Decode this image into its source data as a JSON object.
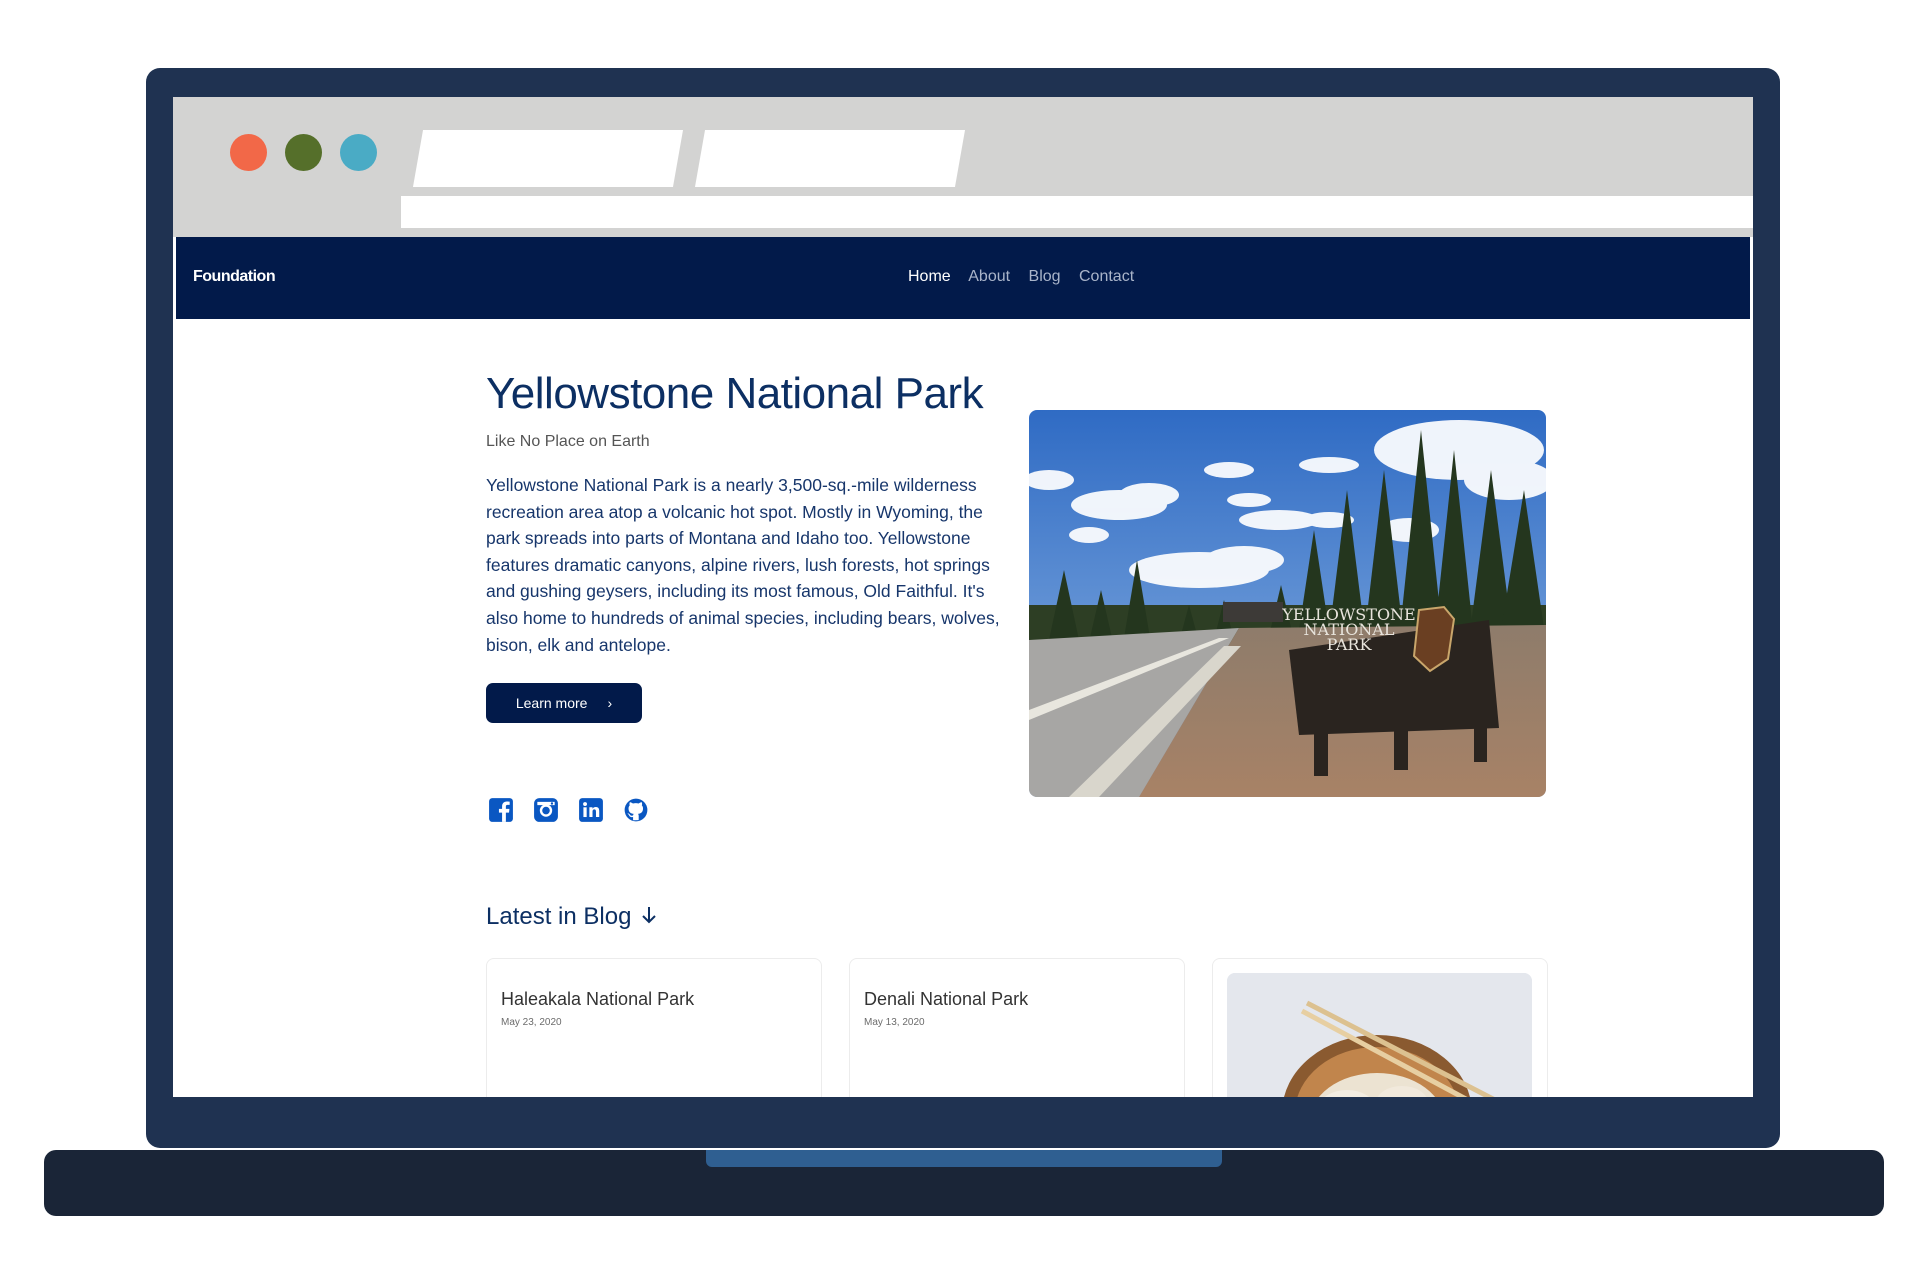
{
  "site": {
    "brand": "Foundation",
    "nav": [
      "Home",
      "About",
      "Blog",
      "Contact"
    ],
    "active_nav": "Home"
  },
  "hero": {
    "title": "Yellowstone National Park",
    "subtitle": "Like No Place on Earth",
    "body": "Yellowstone National Park is a nearly 3,500-sq.-mile wilderness recreation area atop a volcanic hot spot. Mostly in Wyoming, the park spreads into parts of Montana and Idaho too. Yellowstone features dramatic canyons, alpine rivers, lush forests, hot springs and gushing geysers, including its most famous, Old Faithful. It's also home to hundreds of animal species, including bears, wolves, bison, elk and antelope.",
    "button": "Learn more",
    "photo_sign_text": [
      "YELLOWSTONE",
      "NATIONAL",
      "PARK"
    ],
    "social_icons": [
      "facebook-icon",
      "instagram-icon",
      "linkedin-icon",
      "github-icon"
    ]
  },
  "blog": {
    "heading": "Latest in Blog",
    "cards": [
      {
        "title": "Haleakala National Park",
        "date": "May 23, 2020"
      },
      {
        "title": "Denali National Park",
        "date": "May 13, 2020"
      }
    ]
  },
  "colors": {
    "navy": "#021a4a",
    "title_blue": "#0c2f63",
    "icon_blue": "#0a57c2",
    "laptop_frame": "#1f3251",
    "laptop_base": "#1a2537",
    "window_dot_red": "#f26848",
    "window_dot_green": "#556f2a",
    "window_dot_blue": "#4aabc5"
  }
}
